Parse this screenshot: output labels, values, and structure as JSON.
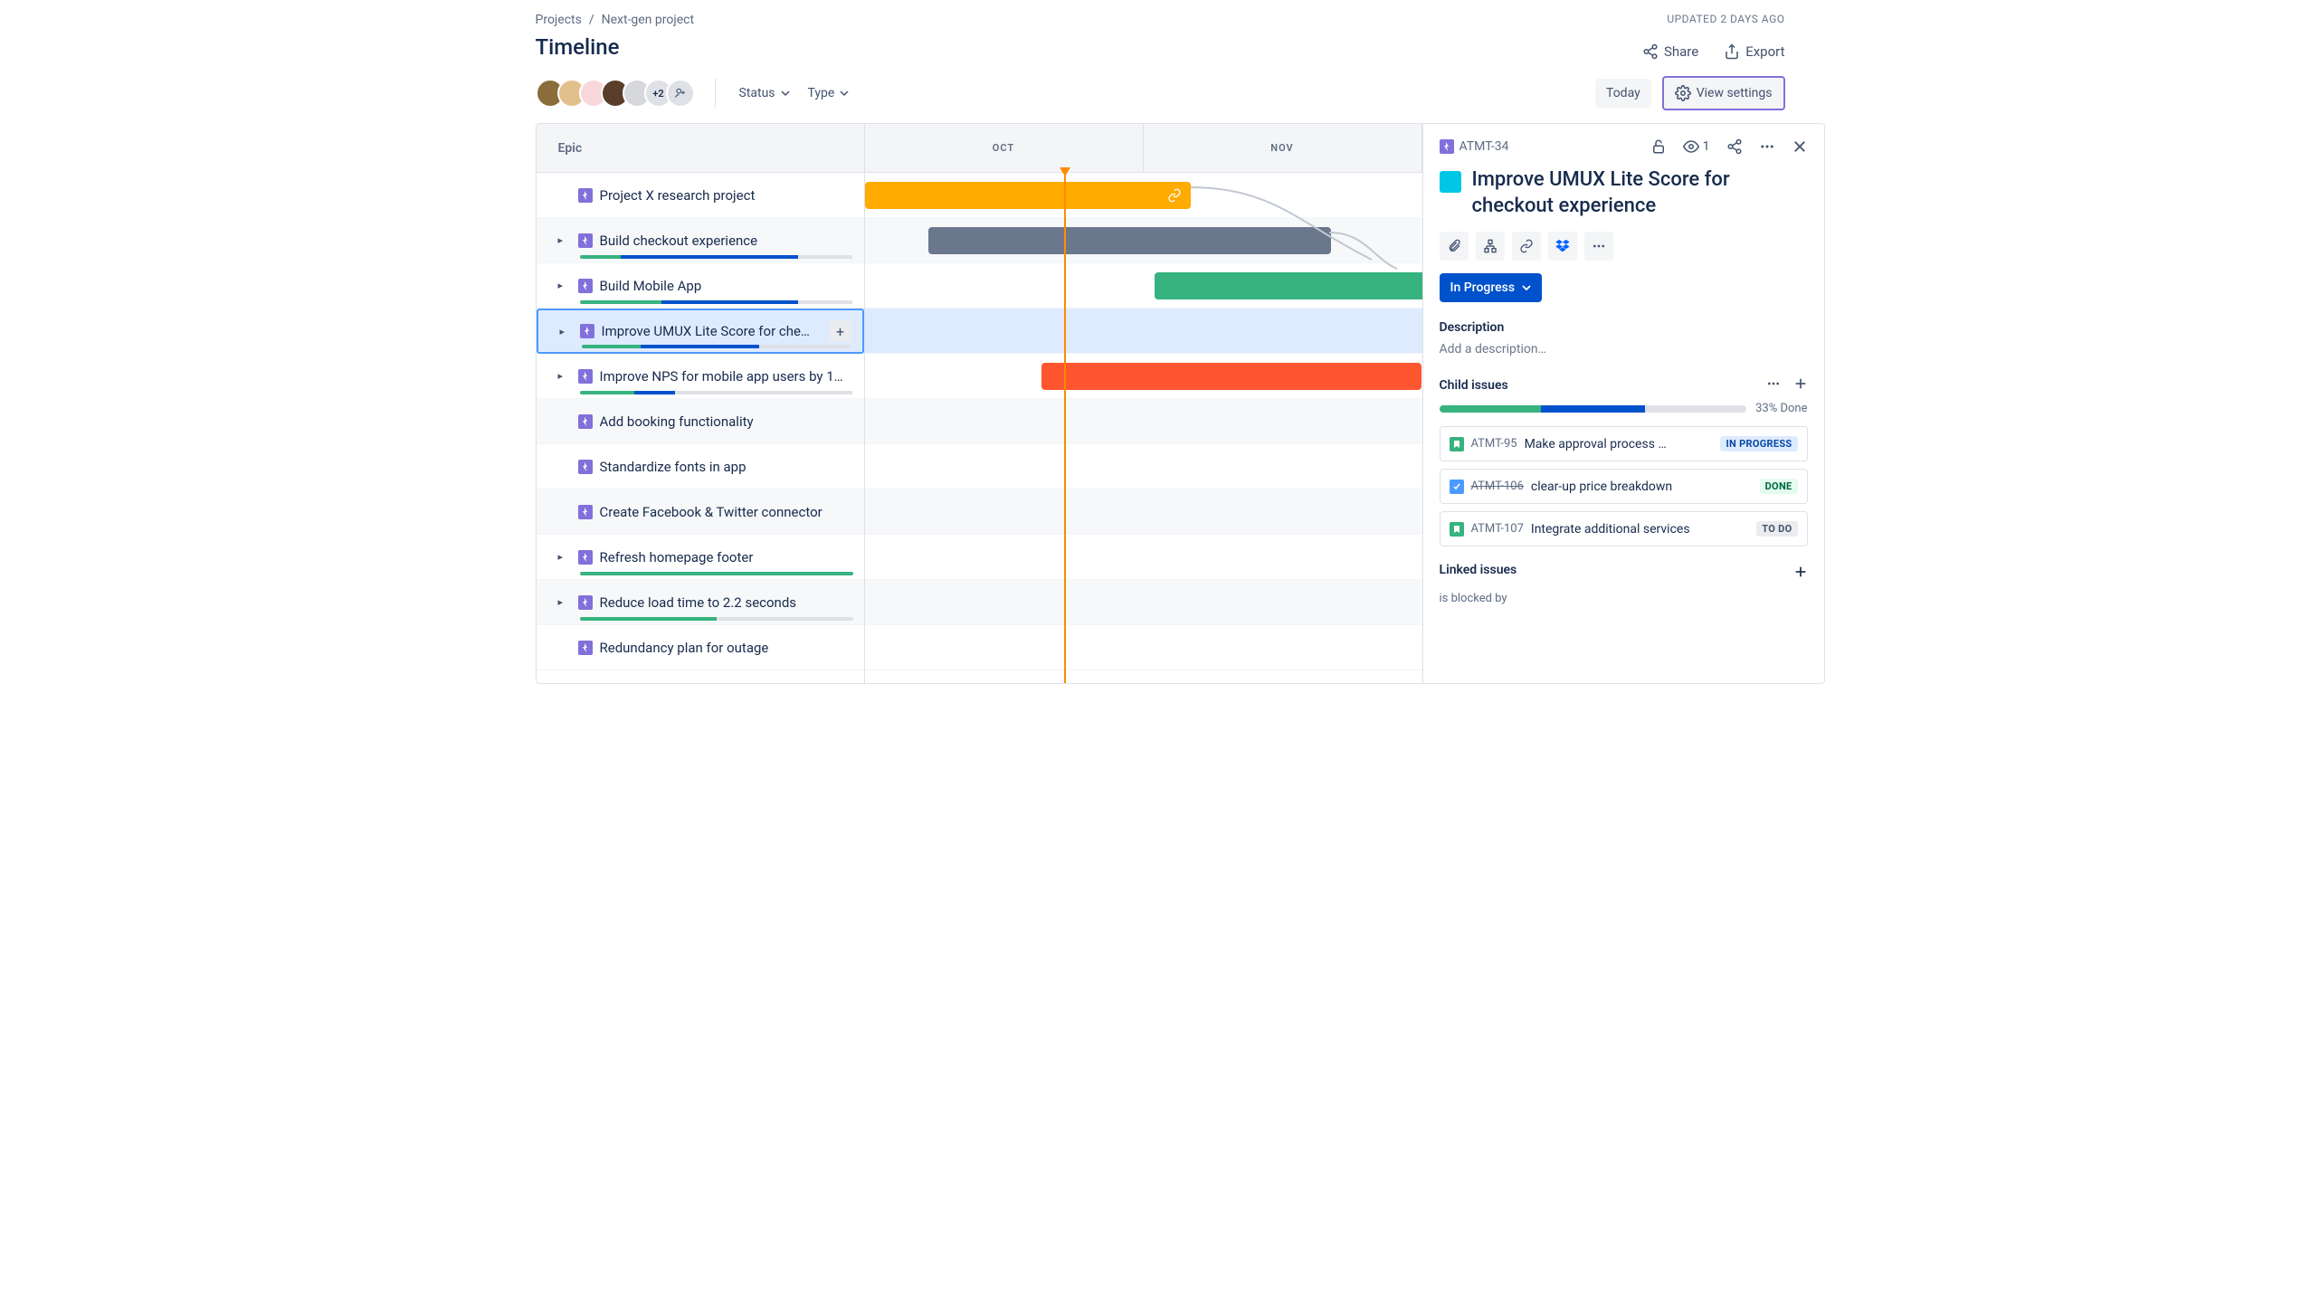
{
  "breadcrumb": {
    "projects": "Projects",
    "current": "Next-gen project"
  },
  "updated": "UPDATED 2 DAYS AGO",
  "page_title": "Timeline",
  "avatars": {
    "extra": "+2"
  },
  "filters": {
    "status": "Status",
    "type": "Type"
  },
  "top_actions": {
    "share": "Share",
    "export": "Export"
  },
  "buttons": {
    "today": "Today",
    "view_settings": "View settings"
  },
  "timeline": {
    "header": "Epic",
    "months": [
      "OCT",
      "NOV"
    ],
    "epics": [
      {
        "title": "Project X research project",
        "expandable": false,
        "progress": null
      },
      {
        "title": "Build checkout experience",
        "expandable": true,
        "progress": {
          "g": 15,
          "b": 65,
          "gr": 20
        }
      },
      {
        "title": "Build Mobile App",
        "expandable": true,
        "progress": {
          "g": 30,
          "b": 50,
          "gr": 20
        }
      },
      {
        "title": "Improve UMUX Lite Score for che…",
        "expandable": true,
        "selected": true,
        "progress": {
          "g": 22,
          "b": 44,
          "gr": 34
        }
      },
      {
        "title": "Improve NPS for mobile app users by 1…",
        "expandable": true,
        "progress": {
          "g": 20,
          "b": 15,
          "gr": 65
        }
      },
      {
        "title": "Add booking functionality",
        "expandable": false,
        "progress": null
      },
      {
        "title": "Standardize fonts in app",
        "expandable": false,
        "progress": null
      },
      {
        "title": "Create Facebook & Twitter connector",
        "expandable": false,
        "progress": null
      },
      {
        "title": "Refresh homepage footer",
        "expandable": true,
        "progress": {
          "g": 100,
          "b": 0,
          "gr": 0
        }
      },
      {
        "title": "Reduce load time to 2.2 seconds",
        "expandable": true,
        "progress": {
          "g": 50,
          "b": 0,
          "gr": 50
        }
      },
      {
        "title": "Redundancy plan for outage",
        "expandable": false,
        "progress": null
      }
    ]
  },
  "panel": {
    "key": "ATMT-34",
    "watch_count": "1",
    "title": "Improve UMUX Lite Score for checkout experience",
    "status": "In Progress",
    "desc_heading": "Description",
    "desc_placeholder": "Add a description…",
    "child_heading": "Child issues",
    "done_pct": "33% Done",
    "child_prog": {
      "g": 33,
      "b": 34,
      "gr": 33
    },
    "children": [
      {
        "icon": "story",
        "key": "ATMT-95",
        "title": "Make approval process …",
        "status": "IN PROGRESS",
        "lozenge": "inprog"
      },
      {
        "icon": "task",
        "key": "ATMT-106",
        "title": "clear-up price breakdown",
        "status": "DONE",
        "lozenge": "done",
        "struck": true
      },
      {
        "icon": "story",
        "key": "ATMT-107",
        "title": "Integrate additional services",
        "status": "TO DO",
        "lozenge": "todo"
      }
    ],
    "linked_heading": "Linked issues",
    "blocked": "is blocked by"
  }
}
